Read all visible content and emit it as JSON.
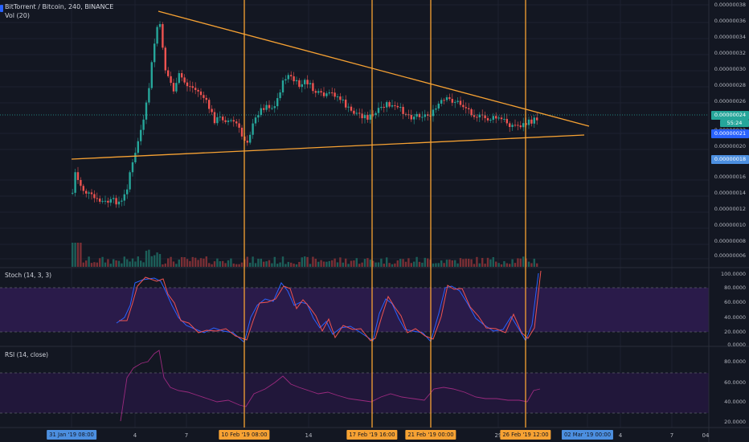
{
  "header": {
    "symbol_line": "BitTorrent / Bitcoin, 240, BINANCE",
    "volume_label": "Vol (20)"
  },
  "price_axis": {
    "ticks": [
      "0.00000038",
      "0.00000036",
      "0.00000034",
      "0.00000032",
      "0.00000030",
      "0.00000028",
      "0.00000026",
      "0.00000022",
      "0.00000020",
      "0.00000016",
      "0.00000014",
      "0.00000012",
      "0.00000010",
      "0.00000008",
      "0.00000006"
    ],
    "current_price": "0.00000024",
    "countdown": "55:24",
    "cursor_price": "0.00000021",
    "flag_price": "0.00000018"
  },
  "stoch": {
    "label": "Stoch (14, 3, 3)",
    "ticks": [
      "100.0000",
      "80.0000",
      "60.0000",
      "40.0000",
      "20.0000",
      "0.0000"
    ]
  },
  "rsi": {
    "label": "RSI (14, close)",
    "ticks": [
      "80.0000",
      "60.0000",
      "40.0000",
      "20.0000"
    ]
  },
  "time_axis": {
    "ticks": [
      "4",
      "7",
      "14",
      "29",
      "4",
      "7"
    ],
    "end_tick": "04"
  },
  "date_tags": [
    {
      "label": "31 Jan '19   08:00",
      "color": "#4c8fe0"
    },
    {
      "label": "10 Feb '19   08:00",
      "color": "#f7a233"
    },
    {
      "label": "17 Feb '19   16:00",
      "color": "#f7a233"
    },
    {
      "label": "21 Feb '19   00:00",
      "color": "#f7a233"
    },
    {
      "label": "26 Feb '19   12:00",
      "color": "#f7a233"
    },
    {
      "label": "02 Mar '19   00:00",
      "color": "#4c8fe0"
    }
  ],
  "colors": {
    "background": "#131722",
    "up_candle": "#26a69a",
    "down_candle": "#ef5350",
    "drawing": "#f7a233",
    "stoch_k": "#2962ff",
    "stoch_d": "#ef5350",
    "rsi_line": "#9c2a7f",
    "band_fill": "#2a1b4a"
  }
}
